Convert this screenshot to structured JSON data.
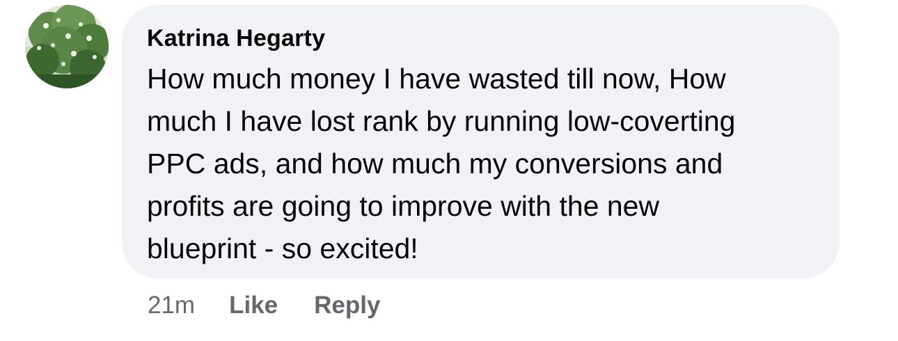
{
  "comment": {
    "avatar": {
      "icon": "profile-photo-tree",
      "colors": [
        "#4f7a3b",
        "#8fb07a",
        "#dfe6d6"
      ]
    },
    "author": "Katrina Hegarty",
    "text": "How much money I have wasted till now,  How\nmuch I have lost rank by running low-coverting\nPPC ads, and how much my conversions and\nprofits are going to improve with the new\nblueprint - so excited!",
    "timestamp": "21m",
    "like_label": "Like",
    "reply_label": "Reply"
  },
  "colors": {
    "bubble_bg": "#f0f2f5",
    "text": "#050505",
    "secondary": "#65676b"
  }
}
